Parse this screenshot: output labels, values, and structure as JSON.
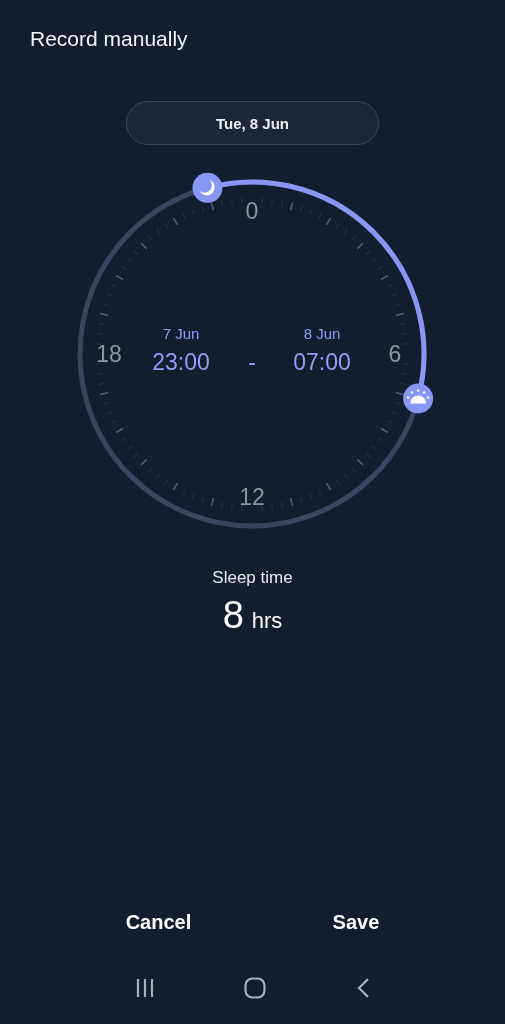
{
  "title": "Record manually",
  "date": "Tue, 8 Jun",
  "dial": {
    "labels": [
      "0",
      "6",
      "12",
      "18"
    ]
  },
  "start": {
    "date": "7 Jun",
    "time": "23:00"
  },
  "separator": "-",
  "end": {
    "date": "8 Jun",
    "time": "07:00"
  },
  "sleep": {
    "label": "Sleep time",
    "value": "8",
    "unit": "hrs"
  },
  "buttons": [
    "Cancel",
    "Save"
  ]
}
